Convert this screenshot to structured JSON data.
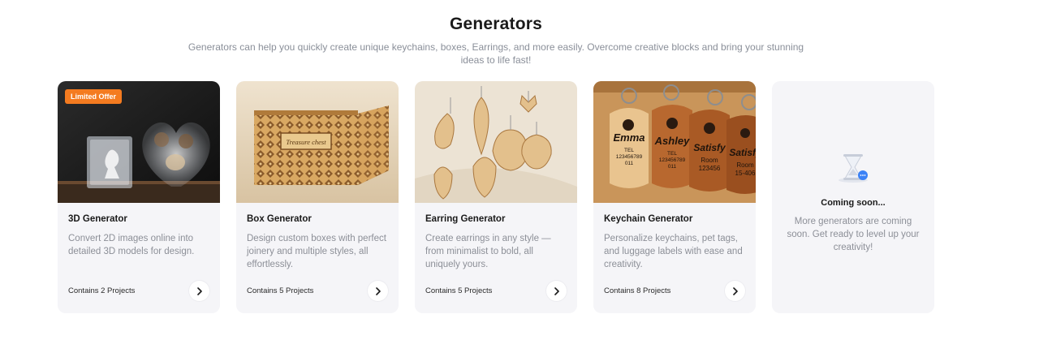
{
  "header": {
    "title": "Generators",
    "subtitle": "Generators can help you quickly create unique keychains, boxes, Earrings, and more easily. Overcome creative blocks and bring your stunning ideas to life fast!"
  },
  "cards": [
    {
      "badge": "Limited Offer",
      "name": "3D Generator",
      "description": "Convert 2D images online into detailed 3D models for design.",
      "count": "Contains 2 Projects",
      "image": "crystal-heart-photo"
    },
    {
      "name": "Box Generator",
      "description": "Design custom boxes with perfect joinery and multiple styles, all effortlessly.",
      "count": "Contains 5 Projects",
      "image": "wooden-box-photo",
      "image_text": "Treasure chest"
    },
    {
      "name": "Earring Generator",
      "description": "Create earrings in any style — from minimalist to bold, all uniquely yours.",
      "count": "Contains 5 Projects",
      "image": "wooden-earrings-photo"
    },
    {
      "name": "Keychain Generator",
      "description": "Personalize keychains, pet tags, and luggage labels with ease and creativity.",
      "count": "Contains 8 Projects",
      "image": "wooden-keychains-photo",
      "tags": [
        {
          "name": "Emma",
          "line1": "TEL",
          "line2": "123456789",
          "line3": "011"
        },
        {
          "name": "Ashley",
          "line1": "TEL",
          "line2": "123456789",
          "line3": "011"
        },
        {
          "name": "Satisfy",
          "line1": "Room",
          "line2": "123456",
          "line3": ""
        },
        {
          "name": "Satisfy",
          "line1": "Room",
          "line2": "15-406",
          "line3": ""
        }
      ]
    }
  ],
  "coming_soon": {
    "title": "Coming soon...",
    "description": "More generators are coming soon. Get ready to level up your creativity!",
    "icon": "hourglass-icon"
  },
  "colors": {
    "badge": "#f47b20",
    "card_bg": "#f5f5f8",
    "muted_text": "#8c8f97",
    "accent_blue": "#3b82f6"
  }
}
